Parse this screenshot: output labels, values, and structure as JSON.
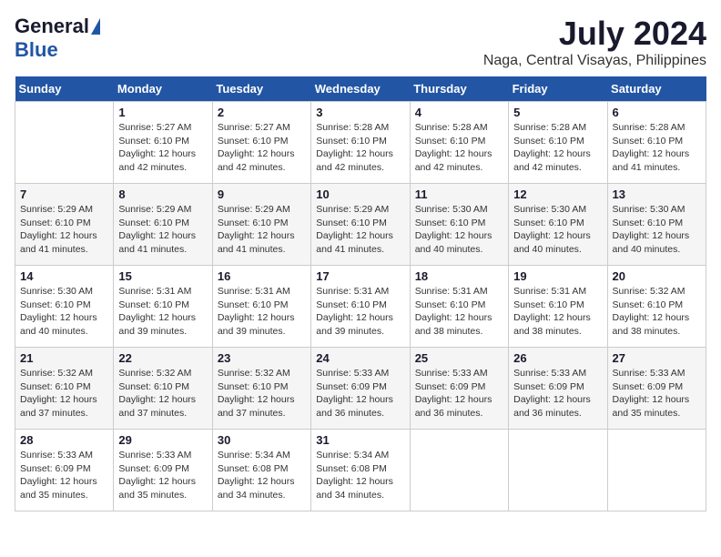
{
  "logo": {
    "general": "General",
    "blue": "Blue"
  },
  "header": {
    "month": "July 2024",
    "location": "Naga, Central Visayas, Philippines"
  },
  "weekdays": [
    "Sunday",
    "Monday",
    "Tuesday",
    "Wednesday",
    "Thursday",
    "Friday",
    "Saturday"
  ],
  "weeks": [
    [
      {
        "day": "",
        "sunrise": "",
        "sunset": "",
        "daylight": ""
      },
      {
        "day": "1",
        "sunrise": "Sunrise: 5:27 AM",
        "sunset": "Sunset: 6:10 PM",
        "daylight": "Daylight: 12 hours and 42 minutes."
      },
      {
        "day": "2",
        "sunrise": "Sunrise: 5:27 AM",
        "sunset": "Sunset: 6:10 PM",
        "daylight": "Daylight: 12 hours and 42 minutes."
      },
      {
        "day": "3",
        "sunrise": "Sunrise: 5:28 AM",
        "sunset": "Sunset: 6:10 PM",
        "daylight": "Daylight: 12 hours and 42 minutes."
      },
      {
        "day": "4",
        "sunrise": "Sunrise: 5:28 AM",
        "sunset": "Sunset: 6:10 PM",
        "daylight": "Daylight: 12 hours and 42 minutes."
      },
      {
        "day": "5",
        "sunrise": "Sunrise: 5:28 AM",
        "sunset": "Sunset: 6:10 PM",
        "daylight": "Daylight: 12 hours and 42 minutes."
      },
      {
        "day": "6",
        "sunrise": "Sunrise: 5:28 AM",
        "sunset": "Sunset: 6:10 PM",
        "daylight": "Daylight: 12 hours and 41 minutes."
      }
    ],
    [
      {
        "day": "7",
        "sunrise": "Sunrise: 5:29 AM",
        "sunset": "Sunset: 6:10 PM",
        "daylight": "Daylight: 12 hours and 41 minutes."
      },
      {
        "day": "8",
        "sunrise": "Sunrise: 5:29 AM",
        "sunset": "Sunset: 6:10 PM",
        "daylight": "Daylight: 12 hours and 41 minutes."
      },
      {
        "day": "9",
        "sunrise": "Sunrise: 5:29 AM",
        "sunset": "Sunset: 6:10 PM",
        "daylight": "Daylight: 12 hours and 41 minutes."
      },
      {
        "day": "10",
        "sunrise": "Sunrise: 5:29 AM",
        "sunset": "Sunset: 6:10 PM",
        "daylight": "Daylight: 12 hours and 41 minutes."
      },
      {
        "day": "11",
        "sunrise": "Sunrise: 5:30 AM",
        "sunset": "Sunset: 6:10 PM",
        "daylight": "Daylight: 12 hours and 40 minutes."
      },
      {
        "day": "12",
        "sunrise": "Sunrise: 5:30 AM",
        "sunset": "Sunset: 6:10 PM",
        "daylight": "Daylight: 12 hours and 40 minutes."
      },
      {
        "day": "13",
        "sunrise": "Sunrise: 5:30 AM",
        "sunset": "Sunset: 6:10 PM",
        "daylight": "Daylight: 12 hours and 40 minutes."
      }
    ],
    [
      {
        "day": "14",
        "sunrise": "Sunrise: 5:30 AM",
        "sunset": "Sunset: 6:10 PM",
        "daylight": "Daylight: 12 hours and 40 minutes."
      },
      {
        "day": "15",
        "sunrise": "Sunrise: 5:31 AM",
        "sunset": "Sunset: 6:10 PM",
        "daylight": "Daylight: 12 hours and 39 minutes."
      },
      {
        "day": "16",
        "sunrise": "Sunrise: 5:31 AM",
        "sunset": "Sunset: 6:10 PM",
        "daylight": "Daylight: 12 hours and 39 minutes."
      },
      {
        "day": "17",
        "sunrise": "Sunrise: 5:31 AM",
        "sunset": "Sunset: 6:10 PM",
        "daylight": "Daylight: 12 hours and 39 minutes."
      },
      {
        "day": "18",
        "sunrise": "Sunrise: 5:31 AM",
        "sunset": "Sunset: 6:10 PM",
        "daylight": "Daylight: 12 hours and 38 minutes."
      },
      {
        "day": "19",
        "sunrise": "Sunrise: 5:31 AM",
        "sunset": "Sunset: 6:10 PM",
        "daylight": "Daylight: 12 hours and 38 minutes."
      },
      {
        "day": "20",
        "sunrise": "Sunrise: 5:32 AM",
        "sunset": "Sunset: 6:10 PM",
        "daylight": "Daylight: 12 hours and 38 minutes."
      }
    ],
    [
      {
        "day": "21",
        "sunrise": "Sunrise: 5:32 AM",
        "sunset": "Sunset: 6:10 PM",
        "daylight": "Daylight: 12 hours and 37 minutes."
      },
      {
        "day": "22",
        "sunrise": "Sunrise: 5:32 AM",
        "sunset": "Sunset: 6:10 PM",
        "daylight": "Daylight: 12 hours and 37 minutes."
      },
      {
        "day": "23",
        "sunrise": "Sunrise: 5:32 AM",
        "sunset": "Sunset: 6:10 PM",
        "daylight": "Daylight: 12 hours and 37 minutes."
      },
      {
        "day": "24",
        "sunrise": "Sunrise: 5:33 AM",
        "sunset": "Sunset: 6:09 PM",
        "daylight": "Daylight: 12 hours and 36 minutes."
      },
      {
        "day": "25",
        "sunrise": "Sunrise: 5:33 AM",
        "sunset": "Sunset: 6:09 PM",
        "daylight": "Daylight: 12 hours and 36 minutes."
      },
      {
        "day": "26",
        "sunrise": "Sunrise: 5:33 AM",
        "sunset": "Sunset: 6:09 PM",
        "daylight": "Daylight: 12 hours and 36 minutes."
      },
      {
        "day": "27",
        "sunrise": "Sunrise: 5:33 AM",
        "sunset": "Sunset: 6:09 PM",
        "daylight": "Daylight: 12 hours and 35 minutes."
      }
    ],
    [
      {
        "day": "28",
        "sunrise": "Sunrise: 5:33 AM",
        "sunset": "Sunset: 6:09 PM",
        "daylight": "Daylight: 12 hours and 35 minutes."
      },
      {
        "day": "29",
        "sunrise": "Sunrise: 5:33 AM",
        "sunset": "Sunset: 6:09 PM",
        "daylight": "Daylight: 12 hours and 35 minutes."
      },
      {
        "day": "30",
        "sunrise": "Sunrise: 5:34 AM",
        "sunset": "Sunset: 6:08 PM",
        "daylight": "Daylight: 12 hours and 34 minutes."
      },
      {
        "day": "31",
        "sunrise": "Sunrise: 5:34 AM",
        "sunset": "Sunset: 6:08 PM",
        "daylight": "Daylight: 12 hours and 34 minutes."
      },
      {
        "day": "",
        "sunrise": "",
        "sunset": "",
        "daylight": ""
      },
      {
        "day": "",
        "sunrise": "",
        "sunset": "",
        "daylight": ""
      },
      {
        "day": "",
        "sunrise": "",
        "sunset": "",
        "daylight": ""
      }
    ]
  ]
}
